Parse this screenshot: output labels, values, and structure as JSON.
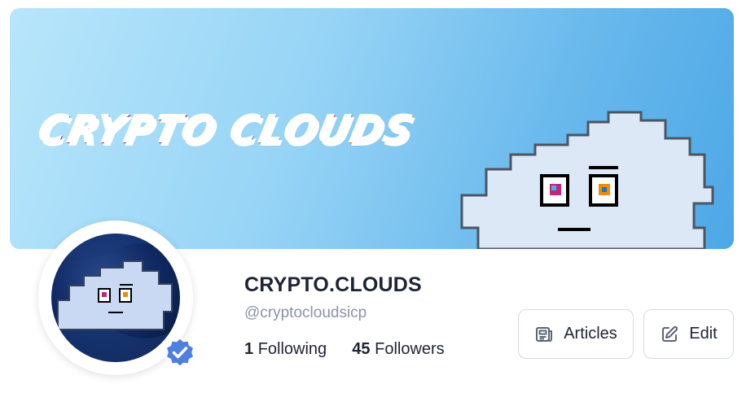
{
  "banner": {
    "title_word1": "CRYPTO",
    "title_word2": "CLOUDS"
  },
  "profile": {
    "display_name": "CRYPTO.CLOUDS",
    "handle": "@cryptocloudsicp",
    "verified": true,
    "following_count": "1",
    "following_label": "Following",
    "followers_count": "45",
    "followers_label": "Followers"
  },
  "actions": {
    "articles_label": "Articles",
    "edit_label": "Edit"
  },
  "icons": {
    "articles": "newspaper-icon",
    "edit": "edit-icon",
    "verified": "verified-badge-icon"
  },
  "colors": {
    "verified_badge": "#4f7fe0",
    "banner_sky_start": "#b8e6fb",
    "banner_sky_end": "#4da8e6",
    "text_primary": "#1e2433",
    "text_secondary": "#8a93a6",
    "button_border": "#d6dae2"
  }
}
